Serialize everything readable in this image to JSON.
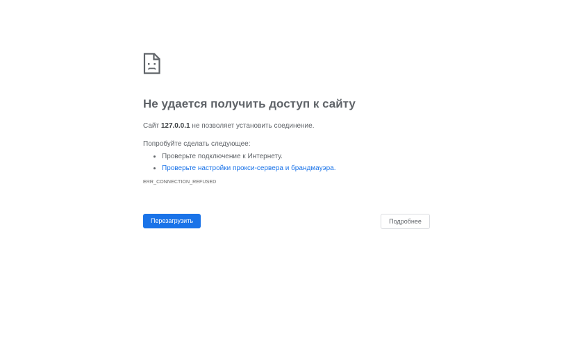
{
  "error_page": {
    "icon": "sad-document-icon",
    "title": "Не удается получить доступ к сайту",
    "message_prefix": "Сайт",
    "host": "127.0.0.1",
    "message_suffix": "не позволяет установить соединение.",
    "suggestions_heading": "Попробуйте сделать следующее:",
    "suggestions": [
      "Проверьте подключение к Интернету.",
      "Проверьте настройки прокси-сервера и брандмауэра."
    ],
    "error_code": "ERR_CONNECTION_REFUSED",
    "reload_label": "Перезагрузить",
    "details_label": "Подробнее",
    "colors": {
      "accent": "#1a73e8",
      "text": "#5f6368",
      "link": "#1a73e8"
    }
  }
}
